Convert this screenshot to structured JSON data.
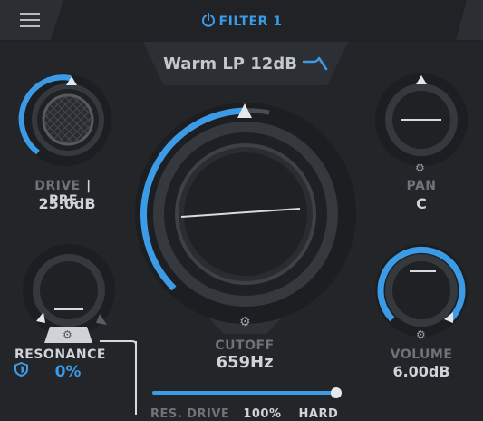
{
  "header": {
    "title": "FILTER 1",
    "menu_icon": "hamburger-icon",
    "power_icon": "power-icon"
  },
  "preset": {
    "name": "Warm LP 12dB",
    "icon": "lowpass-curve-icon"
  },
  "drive": {
    "label": "DRIVE",
    "mode": "PRE",
    "value": "25.0dB",
    "level": 0.55
  },
  "pan": {
    "label": "PAN",
    "value": "C"
  },
  "cutoff": {
    "label": "CUTOFF",
    "value": "659Hz",
    "level": 0.3
  },
  "resonance": {
    "label": "RESONANCE",
    "value": "0%",
    "shield_icon": "shield-icon"
  },
  "volume": {
    "label": "VOLUME",
    "value": "6.00dB",
    "level": 1.0
  },
  "res_drive": {
    "label": "RES. DRIVE",
    "value": "100%",
    "mode": "HARD",
    "level": 1.0
  },
  "colors": {
    "accent": "#3b9be6",
    "background": "#232529"
  }
}
